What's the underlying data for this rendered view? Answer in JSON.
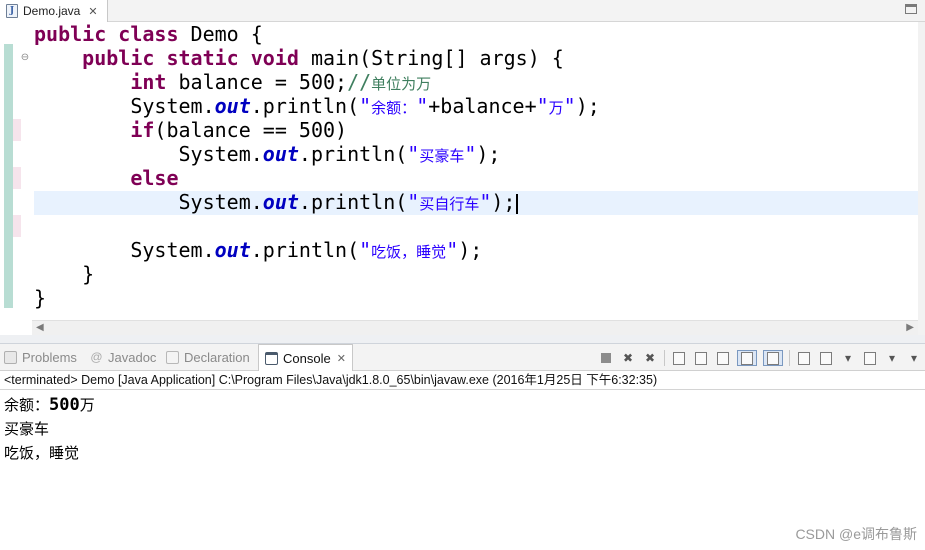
{
  "editor": {
    "tab_label": "Demo.java",
    "tab_icon": "java-file-icon",
    "code_lines": [
      "public class Demo {",
      "    public static void main(String[] args) {",
      "        int balance = 500;//单位为万",
      "        System.out.println(\"余额：\"+balance+\"万\");",
      "        if(balance == 500)",
      "            System.out.println(\"买豪车\");",
      "        else",
      "            System.out.println(\"买自行车\");",
      "",
      "        System.out.println(\"吃饭，睡觉\");",
      "    }",
      "}"
    ],
    "current_line_index": 7,
    "colors": {
      "keyword": "#7f0055",
      "field": "#0000c0",
      "string": "#2a00ff",
      "comment": "#3f7f5f",
      "current_line": "#e8f2fe"
    }
  },
  "views": {
    "tabs": [
      {
        "label": "Problems",
        "icon": "problems-icon",
        "active": false
      },
      {
        "label": "Javadoc",
        "icon": "javadoc-icon",
        "active": false
      },
      {
        "label": "Declaration",
        "icon": "declaration-icon",
        "active": false
      },
      {
        "label": "Console",
        "icon": "console-icon",
        "active": true
      }
    ]
  },
  "console": {
    "status": "<terminated> Demo [Java Application] C:\\Program Files\\Java\\jdk1.8.0_65\\bin\\javaw.exe (2016年1月25日 下午6:32:35)",
    "output": [
      {
        "prefix": "余额：",
        "number": "500",
        "suffix": "万"
      },
      {
        "text": "买豪车"
      },
      {
        "text": "吃饭，睡觉"
      }
    ]
  },
  "watermark": "CSDN @e调布鲁斯"
}
